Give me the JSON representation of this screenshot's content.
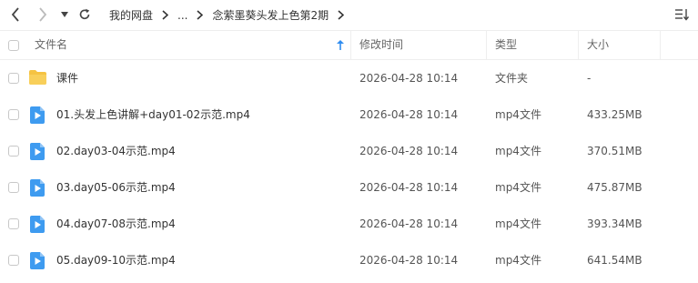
{
  "breadcrumb": {
    "root": "我的网盘",
    "ellipsis": "...",
    "current": "念萦墨葵头发上色第2期"
  },
  "header": {
    "name": "文件名",
    "modified": "修改时间",
    "type": "类型",
    "size": "大小"
  },
  "files": [
    {
      "name": "课件",
      "modified": "2026-04-28 10:14",
      "type": "文件夹",
      "size": "-",
      "icon": "folder-icon"
    },
    {
      "name": "01.头发上色讲解+day01-02示范.mp4",
      "modified": "2026-04-28 10:14",
      "type": "mp4文件",
      "size": "433.25MB",
      "icon": "video-file-icon"
    },
    {
      "name": "02.day03-04示范.mp4",
      "modified": "2026-04-28 10:14",
      "type": "mp4文件",
      "size": "370.51MB",
      "icon": "video-file-icon"
    },
    {
      "name": "03.day05-06示范.mp4",
      "modified": "2026-04-28 10:14",
      "type": "mp4文件",
      "size": "475.87MB",
      "icon": "video-file-icon"
    },
    {
      "name": "04.day07-08示范.mp4",
      "modified": "2026-04-28 10:14",
      "type": "mp4文件",
      "size": "393.34MB",
      "icon": "video-file-icon"
    },
    {
      "name": "05.day09-10示范.mp4",
      "modified": "2026-04-28 10:14",
      "type": "mp4文件",
      "size": "641.54MB",
      "icon": "video-file-icon"
    }
  ],
  "colors": {
    "folder": "#f5c342",
    "video": "#3e9bf0",
    "sort_arrow": "#2f8cf0",
    "border": "#eeeeee"
  }
}
